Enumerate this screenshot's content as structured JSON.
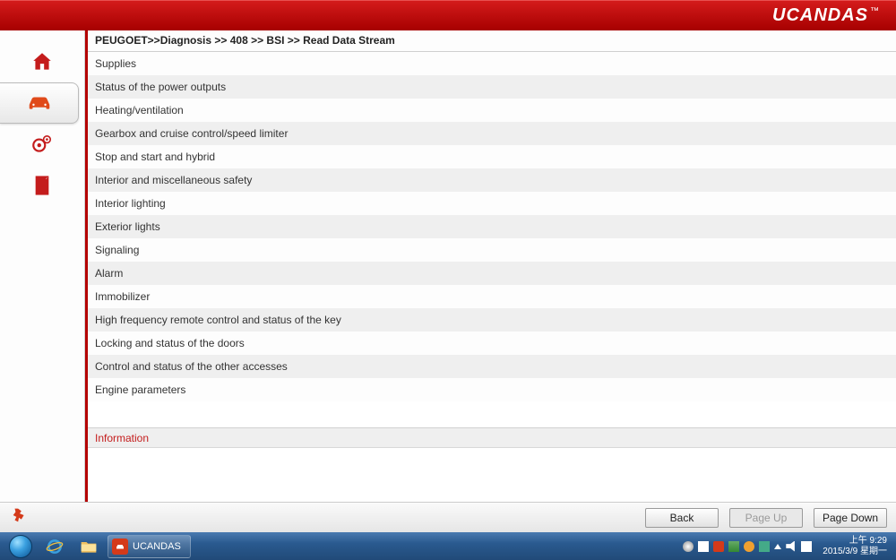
{
  "header": {
    "brand": "UCANDAS",
    "tm": "™"
  },
  "breadcrumb": "PEUGOET>>Diagnosis >> 408 >> BSI >> Read Data Stream",
  "list": {
    "items": [
      "Supplies",
      "Status of the power outputs",
      "Heating/ventilation",
      "Gearbox and cruise control/speed limiter",
      "Stop and start and hybrid",
      "Interior and miscellaneous safety",
      "Interior lighting",
      "Exterior lights",
      "Signaling",
      "Alarm",
      "Immobilizer",
      "High frequency remote control and status of the key",
      "Locking and status of the doors",
      "Control and status of the other accesses",
      "Engine parameters"
    ]
  },
  "info": {
    "header": "Information"
  },
  "footer": {
    "back": "Back",
    "page_up": "Page  Up",
    "page_down": "Page  Down"
  },
  "taskbar": {
    "app_label": "UCANDAS",
    "clock_time": "上午 9:29",
    "clock_date": "2015/3/9 星期一"
  }
}
